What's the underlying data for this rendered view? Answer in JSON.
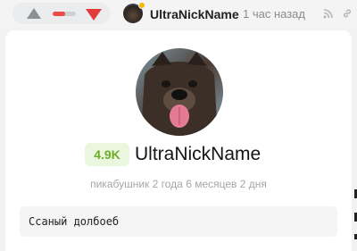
{
  "header": {
    "rating_fill_fraction": 0.55,
    "colors": {
      "upvote": "#8e8f91",
      "downvote": "#e23b3b",
      "rating_bar": "#ea4a4a",
      "status_dot": "#f5b800"
    },
    "author": "UltraNickName",
    "time_ago": "1 час назад",
    "icons": [
      "triangle-up-icon",
      "triangle-down-icon",
      "rss-icon",
      "link-icon"
    ]
  },
  "profile": {
    "badge": "4.9K",
    "badge_color": "#6fae2b",
    "name": "UltraNickName",
    "tenure": "пикабушник 2 года 6 месяцев 2 дня",
    "bio": "Ссаный долбоеб"
  }
}
